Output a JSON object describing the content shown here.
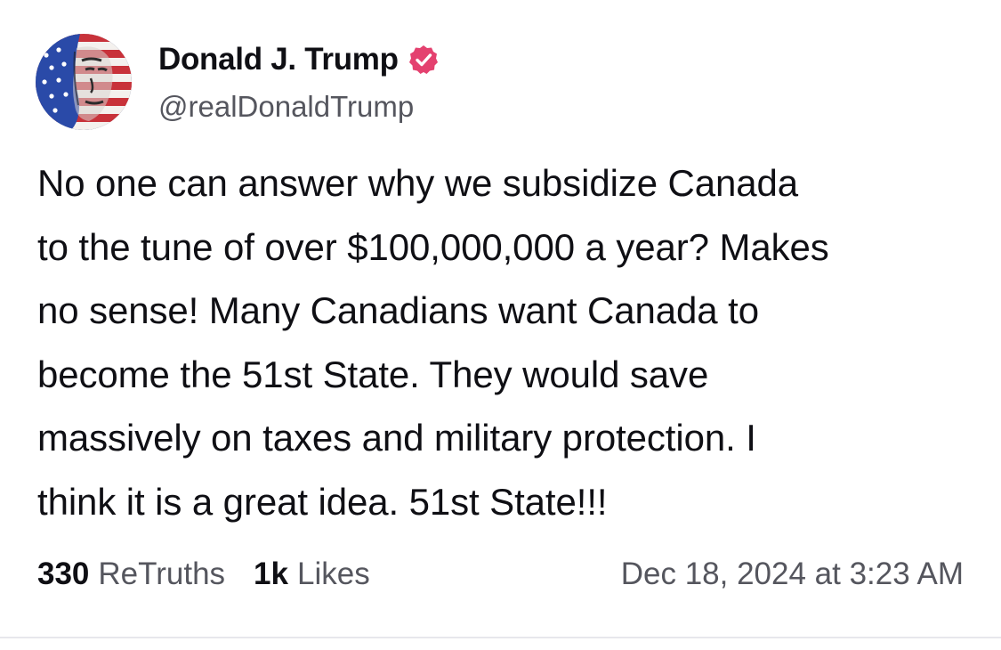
{
  "post": {
    "author": {
      "display_name": "Donald J. Trump",
      "handle": "@realDonaldTrump",
      "verified": true,
      "badge_color": "#e4416f",
      "avatar_icon": "flag-portrait-avatar"
    },
    "body": "No one can answer why we subsidize Canada\nto the tune of over $100,000,000 a year? Makes\nno sense! Many Canadians want Canada to\nbecome the 51st State. They would save\nmassively on taxes and military protection. I\nthink it is a great idea. 51st State!!!",
    "stats": {
      "retruths_count": "330",
      "retruths_label": "ReTruths",
      "likes_count": "1k",
      "likes_label": "Likes"
    },
    "timestamp": "Dec 18, 2024 at 3:23 AM"
  }
}
